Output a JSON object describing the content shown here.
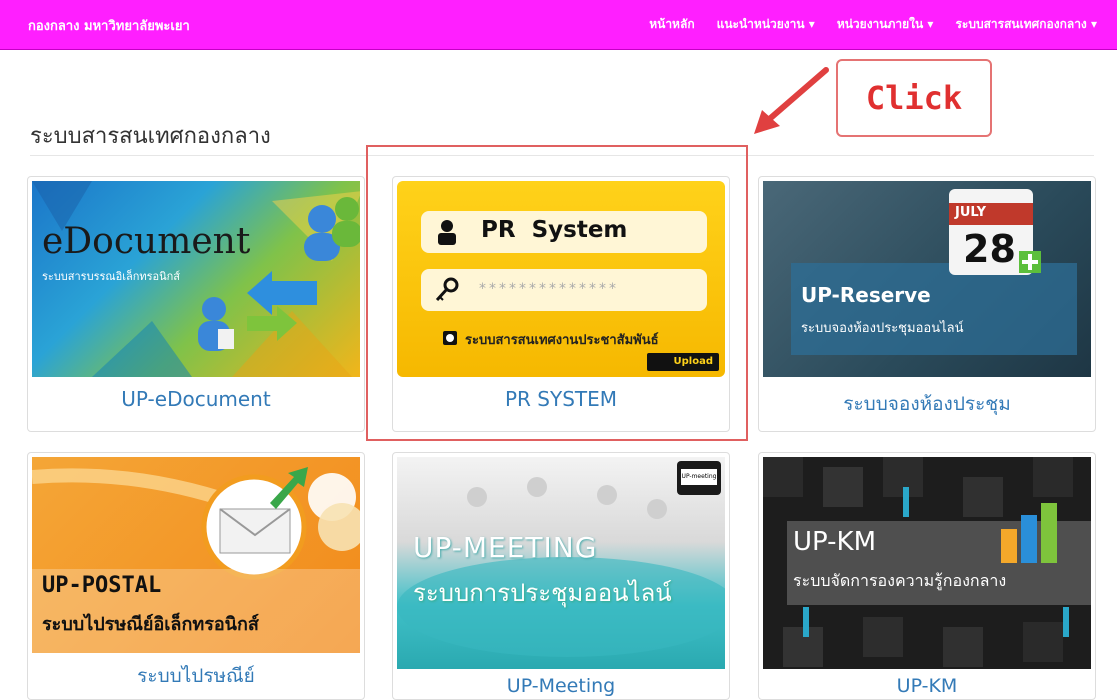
{
  "navbar": {
    "brand": "กองกลาง มหาวิทยาลัยพะเยา",
    "items": [
      {
        "label": "หน้าหลัก"
      },
      {
        "label": "แนะนำหน่วยงาน ▾"
      },
      {
        "label": "หน่วยงานภายใน ▾"
      },
      {
        "label": "ระบบสารสนเทศกองกลาง ▾"
      }
    ]
  },
  "heading": "ระบบสารสนเทศกองกลาง",
  "annotation": {
    "click_label": "Click"
  },
  "cards": [
    {
      "caption": "UP-eDocument",
      "thumb_title": "eDocument",
      "thumb_sub": "ระบบสารบรรณอิเล็กทรอนิกส์"
    },
    {
      "caption": "PR SYSTEM",
      "thumb_title": "PR  System",
      "thumb_password": "**************",
      "thumb_radio": "ระบบสารสนเทศงานประชาสัมพันธ์",
      "thumb_button": "Upload"
    },
    {
      "caption": "ระบบจองห้องประชุม",
      "thumb_title": "UP-Reserve",
      "thumb_sub": "ระบบจองห้องประชุมออนไลน์",
      "cal_month": "JULY",
      "cal_day": "28"
    },
    {
      "caption": "ระบบไปรษณีย์",
      "thumb_title": "UP-POSTAL",
      "thumb_sub": "ระบบไปรษณีย์อิเล็กทรอนิกส์"
    },
    {
      "caption": "UP-Meeting",
      "thumb_title": "UP-MEETING",
      "thumb_sub": "ระบบการประชุมออนไลน์",
      "badge": "UP-meeting"
    },
    {
      "caption": "UP-KM",
      "thumb_title": "UP-KM",
      "thumb_sub": "ระบบจัดการองความรู้กองกลาง"
    }
  ],
  "colors": {
    "navbar": "#ff1fff",
    "link": "#337ab7",
    "highlight": "#e06060"
  }
}
